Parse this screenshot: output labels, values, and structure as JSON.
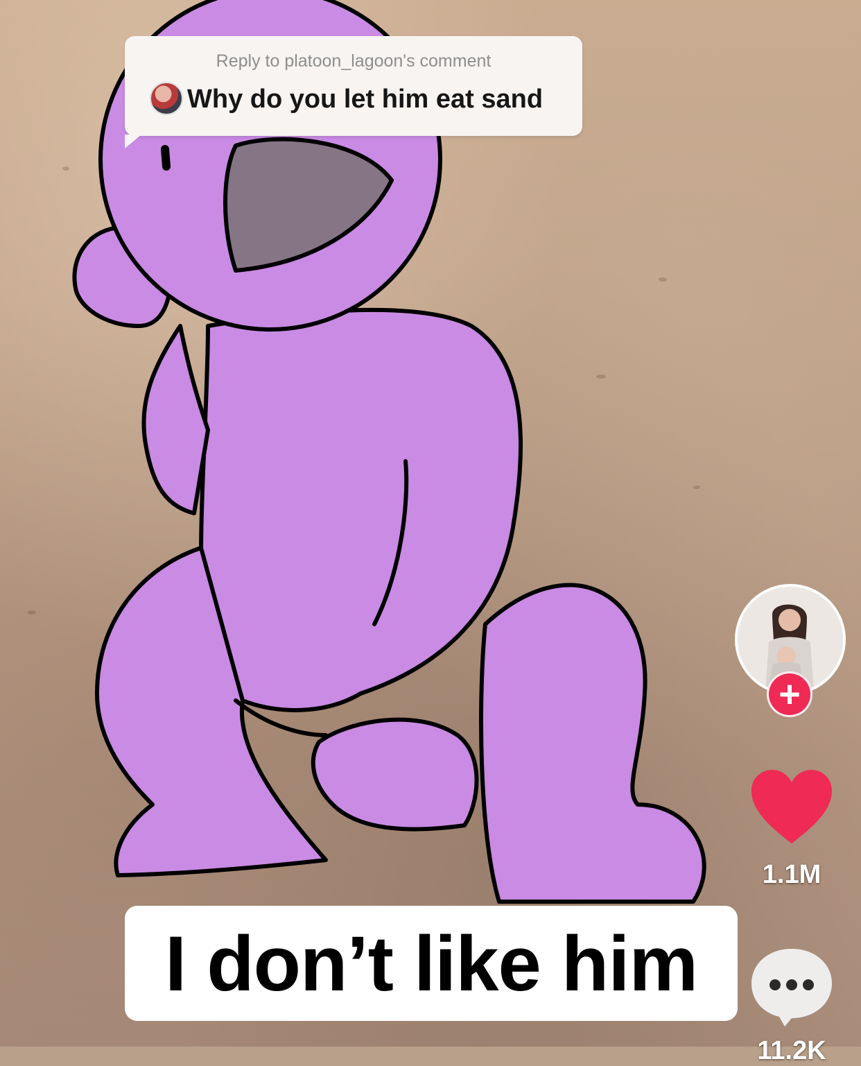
{
  "reply": {
    "header": "Reply to platoon_lagoon's comment",
    "comment": "Why do you let him eat sand"
  },
  "caption": "I don’t like him",
  "sidebar": {
    "follow_symbol": "+",
    "like_count": "1.1M",
    "comment_count": "11.2K"
  },
  "colors": {
    "character_fill": "#c98be3",
    "mouth_fill": "#857585",
    "like_red": "#ee2a55",
    "follow_red": "#ee2a55"
  },
  "icons": [
    "creator-avatar",
    "follow-plus-icon",
    "heart-icon",
    "comment-bubble-icon"
  ]
}
